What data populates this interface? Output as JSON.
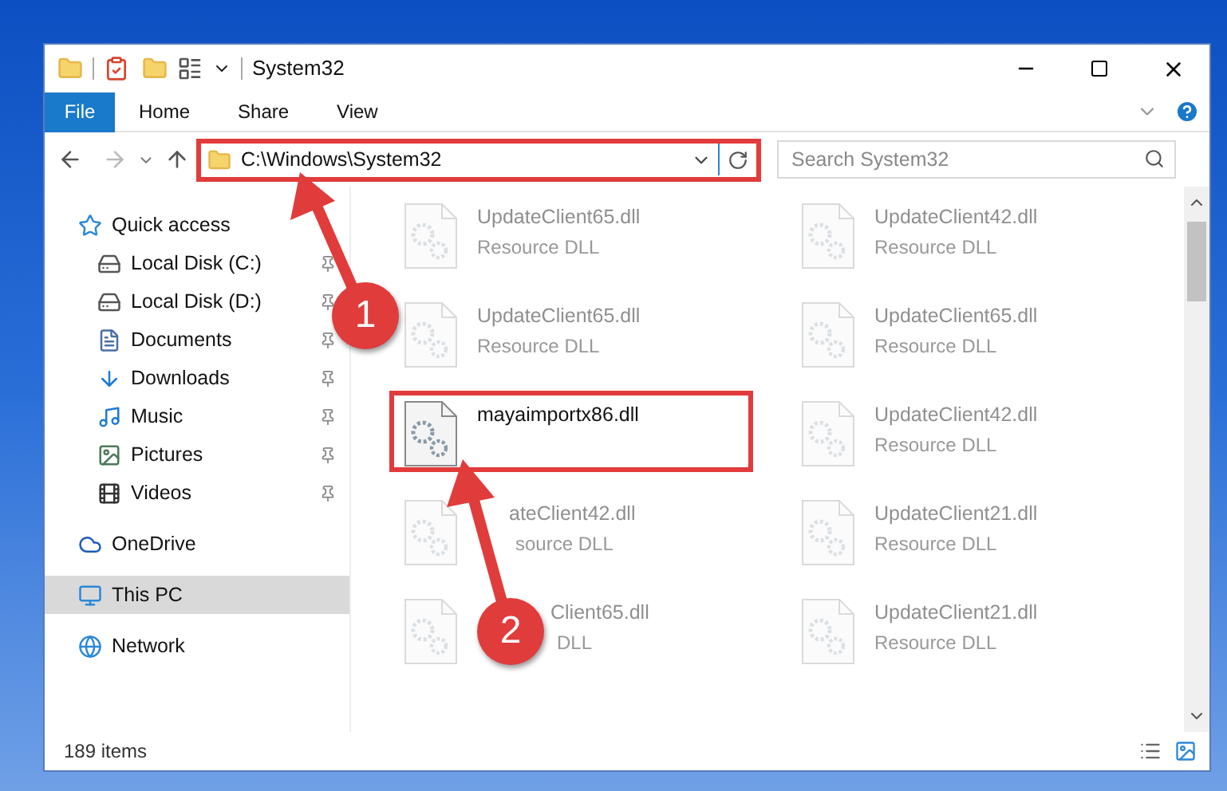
{
  "window": {
    "title": "System32"
  },
  "ribbon_tabs": [
    {
      "label": "File",
      "kind": "file"
    },
    {
      "label": "Home",
      "kind": "tab"
    },
    {
      "label": "Share",
      "kind": "tab"
    },
    {
      "label": "View",
      "kind": "tab"
    }
  ],
  "address_bar": {
    "path": "C:\\Windows\\System32",
    "highlighted": true
  },
  "search": {
    "placeholder": "Search System32"
  },
  "sidebar": {
    "items": [
      {
        "label": "Quick access",
        "kind": "star",
        "selected": false,
        "children": [
          {
            "label": "Local Disk (C:)",
            "kind": "disk",
            "pinned": true,
            "selected": false
          },
          {
            "label": "Local Disk (D:)",
            "kind": "disk",
            "pinned": true,
            "selected": false
          },
          {
            "label": "Documents",
            "kind": "documents",
            "pinned": true,
            "selected": false
          },
          {
            "label": "Downloads",
            "kind": "downloads",
            "pinned": true,
            "selected": false
          },
          {
            "label": "Music",
            "kind": "music",
            "pinned": true,
            "selected": false
          },
          {
            "label": "Pictures",
            "kind": "pictures",
            "pinned": true,
            "selected": false
          },
          {
            "label": "Videos",
            "kind": "videos",
            "pinned": true,
            "selected": false
          }
        ]
      },
      {
        "label": "OneDrive",
        "kind": "cloud",
        "selected": false
      },
      {
        "label": "This PC",
        "kind": "pc",
        "selected": true
      },
      {
        "label": "Network",
        "kind": "network",
        "selected": false
      }
    ]
  },
  "files": [
    {
      "name": "UpdateClient65.dll",
      "type": "Resource DLL",
      "blurred": true,
      "highlighted": false
    },
    {
      "name": "UpdateClient42.dll",
      "type": "Resource DLL",
      "blurred": true,
      "highlighted": false
    },
    {
      "name": "UpdateClient65.dll",
      "type": "Resource DLL",
      "blurred": true,
      "highlighted": false
    },
    {
      "name": "UpdateClient65.dll",
      "type": "Resource DLL",
      "blurred": true,
      "highlighted": false
    },
    {
      "name": "mayaimportx86.dll",
      "blurred": false,
      "highlighted": true
    },
    {
      "name": "UpdateClient42.dll",
      "type": "Resource DLL",
      "blurred": true,
      "highlighted": false
    },
    {
      "name": "ateClient42.dll",
      "type": "source DLL",
      "blurred": true,
      "highlighted": false
    },
    {
      "name": "UpdateClient21.dll",
      "type": "Resource DLL",
      "blurred": true,
      "highlighted": false
    },
    {
      "name": "Client65.dll",
      "type": "DLL",
      "blurred": true,
      "highlighted": false
    },
    {
      "name": "UpdateClient21.dll",
      "type": "Resource DLL",
      "blurred": true,
      "highlighted": false
    }
  ],
  "status_bar": {
    "item_count": "189 items"
  },
  "annotations": [
    {
      "number": "1"
    },
    {
      "number": "2"
    }
  ]
}
